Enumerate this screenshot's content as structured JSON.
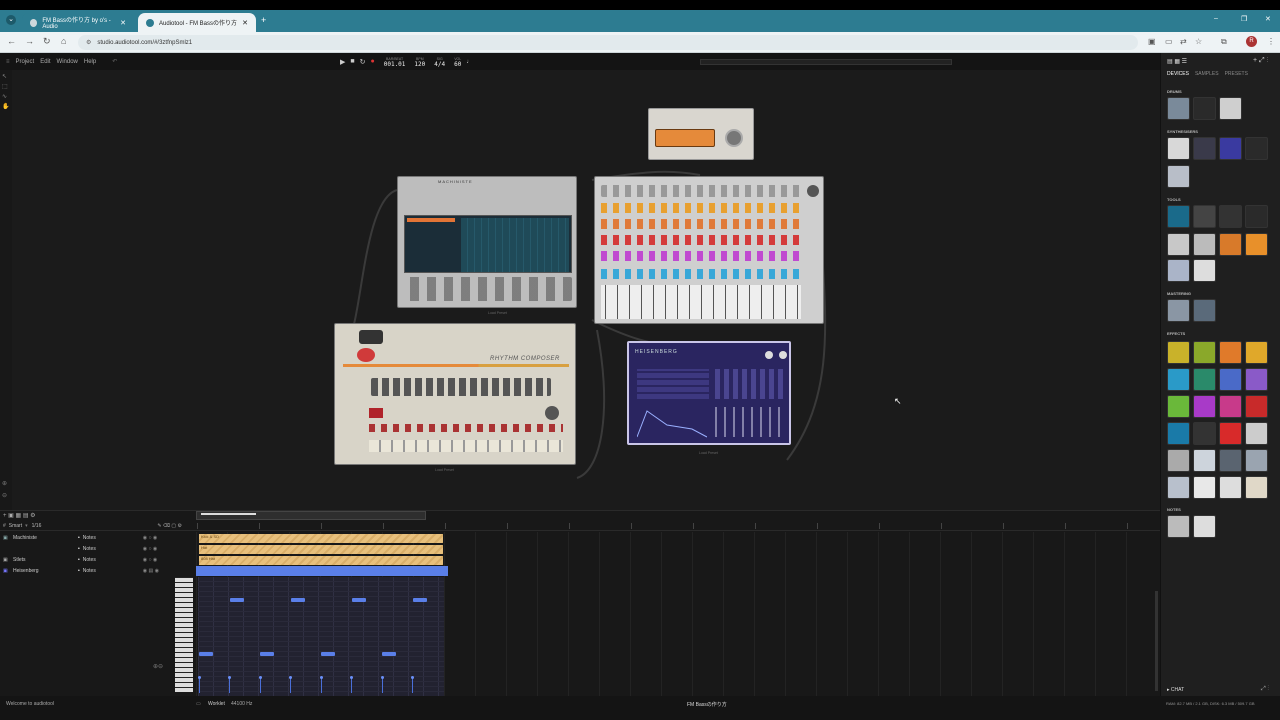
{
  "browser": {
    "tabs": [
      {
        "title": "FM Bassの作り方 by o's - Audio"
      },
      {
        "title": "Audiotool - FM Bassの作り方"
      }
    ],
    "url": "studio.audiotool.com/#/3ztfnpSmlz1"
  },
  "menu": [
    "Project",
    "Edit",
    "Window",
    "Help"
  ],
  "transport": {
    "bar_label": "BAR/BEAT",
    "bar_value": "001.01",
    "bpm_label": "BPM",
    "bpm_value": "120",
    "sig_label": "SIG",
    "sig_value": "4/4",
    "vol_label": "VOL",
    "vol_value": "60"
  },
  "devices": {
    "machiniste_title": "MACHINISTE",
    "rhythm_title": "RHYTHM COMPOSER",
    "heisenberg_title": "HEISENBERG",
    "load_preset": "Load Preset"
  },
  "sidebar": {
    "tabs": [
      "DEVICES",
      "SAMPLES",
      "PRESETS"
    ],
    "categories": {
      "drums": "DRUMS",
      "synth": "SYNTHESISERS",
      "tools": "TOOLS",
      "mastering": "MASTERING",
      "effects": "EFFECTS",
      "notes": "NOTES"
    },
    "chat": "CHAT"
  },
  "sequencer": {
    "snap": "Smart",
    "grid": "1/16",
    "tracks": [
      {
        "name": "Machiniste",
        "type": "Notes"
      },
      {
        "name": "",
        "type": "Notes"
      },
      {
        "name": "Stlets",
        "type": "Notes"
      },
      {
        "name": "Heisenberg",
        "type": "Notes"
      }
    ],
    "clips": [
      "Kick & SD",
      "Hat",
      "808 Hat"
    ]
  },
  "status": {
    "welcome": "Welcome to audiotool",
    "worklet": "Worklet",
    "rate": "44100 Hz",
    "project": "FM Bassの作り方",
    "memory": "RAM: 82.7 MB / 2.1 GB, DISK: 6.3 MB / 509.7 GB"
  },
  "colors": {
    "tabbar": "#2d7c91",
    "accent_blue": "#5a7fe8",
    "clip_tan": "#e8c07c"
  }
}
